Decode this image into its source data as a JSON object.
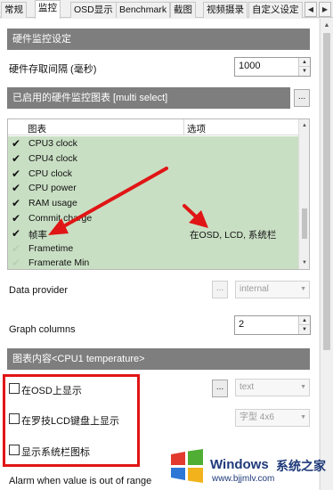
{
  "tabs": [
    {
      "label": "常规",
      "active": false
    },
    {
      "label": "监控",
      "active": true
    },
    {
      "label": "OSD显示",
      "active": false
    },
    {
      "label": "Benchmark",
      "active": false
    },
    {
      "label": "截图",
      "active": false
    },
    {
      "label": "视频摄录",
      "active": false
    },
    {
      "label": "自定义设定",
      "active": false
    }
  ],
  "tab_scroll": {
    "left": "◀",
    "right": "▶"
  },
  "hardware_settings": {
    "header": "硬件监控设定",
    "polling_label": "硬件存取间隔 (毫秒)",
    "polling_value": "1000"
  },
  "enabled_graphs": {
    "header": "已启用的硬件监控图表 [multi select]",
    "ellipsis": "...",
    "columns": {
      "graph": "图表",
      "options": "选项"
    },
    "rows": [
      {
        "name": "CPU3 clock",
        "checked": true,
        "options": ""
      },
      {
        "name": "CPU4 clock",
        "checked": true,
        "options": ""
      },
      {
        "name": "CPU clock",
        "checked": true,
        "options": ""
      },
      {
        "name": "CPU power",
        "checked": true,
        "options": ""
      },
      {
        "name": "RAM usage",
        "checked": true,
        "options": ""
      },
      {
        "name": "Commit charge",
        "checked": true,
        "options": ""
      },
      {
        "name": "帧率",
        "checked": true,
        "options": "在OSD, LCD, 系统栏"
      },
      {
        "name": "Frametime",
        "checked": false,
        "options": ""
      },
      {
        "name": "Framerate Min",
        "checked": false,
        "options": ""
      }
    ]
  },
  "data_provider": {
    "label": "Data provider",
    "ellipsis": "...",
    "value": "internal"
  },
  "graph_columns": {
    "label": "Graph columns",
    "value": "2"
  },
  "graph_properties": {
    "header": "图表内容<CPU1 temperature>",
    "show_osd": {
      "label": "在OSD上显示",
      "checked": false,
      "ellipsis": "...",
      "combo": "text"
    },
    "show_lcd": {
      "label": "在罗技LCD键盘上显示",
      "checked": false,
      "combo": "字型 4x6"
    },
    "show_tray": {
      "label": "显示系统栏图标",
      "checked": false
    },
    "alarm_label": "Alarm when value is out of range"
  },
  "watermark": {
    "title": "Windows",
    "site_cn": "系统之家",
    "url": "www.bjjmlv.com"
  },
  "colors": {
    "header_bg": "#7e7e7e",
    "list_selected_bg": "#c9dfc4",
    "annotation_red": "#e01515"
  }
}
